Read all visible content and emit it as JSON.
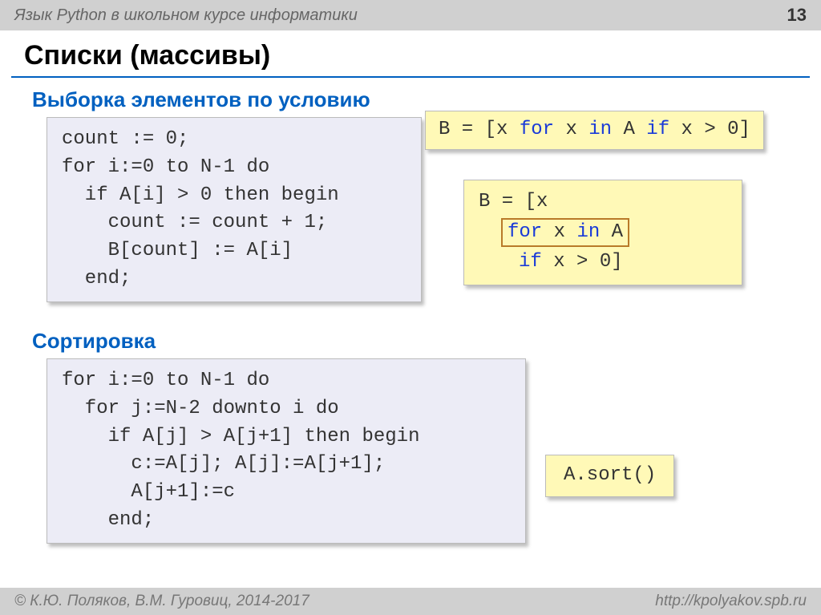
{
  "header": {
    "course": "Язык Python в школьном курсе информатики",
    "page": "13"
  },
  "title": "Списки (массивы)",
  "section1": {
    "heading": "Выборка элементов по условию",
    "pascal": "count := 0;\nfor i:=0 to N-1 do\n  if A[i] > 0 then begin\n    count := count + 1;\n    B[count] := A[i]\n  end;",
    "python_inline": {
      "p0": "B = [x ",
      "kw_for": "for",
      "p1": " x ",
      "kw_in": "in",
      "p2": " A ",
      "kw_if": "if",
      "p3": " x > 0]"
    },
    "python_block": {
      "line1": "B = [x",
      "inner_for": "for",
      "inner_mid": " x ",
      "inner_in": "in",
      "inner_end": " A",
      "line3_if": "if",
      "line3_rest": " x > 0]"
    }
  },
  "section2": {
    "heading": "Сортировка",
    "pascal": "for i:=0 to N-1 do\n  for j:=N-2 downto i do\n    if A[j] > A[j+1] then begin\n      c:=A[j]; A[j]:=A[j+1];\n      A[j+1]:=c\n    end;",
    "python": "A.sort()"
  },
  "footer": {
    "left": "© К.Ю. Поляков, В.М. Гуровиц, 2014-2017",
    "right": "http://kpolyakov.spb.ru"
  }
}
